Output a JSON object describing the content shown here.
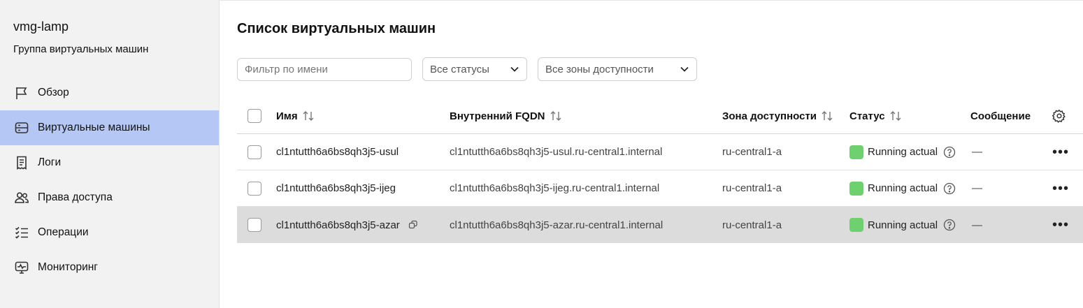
{
  "sidebar": {
    "title": "vmg-lamp",
    "subtitle": "Группа виртуальных машин",
    "items": [
      {
        "label": "Обзор",
        "icon": "flag-icon",
        "active": false
      },
      {
        "label": "Виртуальные машины",
        "icon": "server-icon",
        "active": true
      },
      {
        "label": "Логи",
        "icon": "receipt-icon",
        "active": false
      },
      {
        "label": "Права доступа",
        "icon": "users-icon",
        "active": false
      },
      {
        "label": "Операции",
        "icon": "checklist-icon",
        "active": false
      },
      {
        "label": "Мониторинг",
        "icon": "monitor-icon",
        "active": false
      }
    ]
  },
  "main": {
    "title": "Список виртуальных машин",
    "filter": {
      "placeholder": "Фильтр по имени",
      "value": ""
    },
    "status_select": "Все статусы",
    "zone_select": "Все зоны доступности"
  },
  "table": {
    "columns": {
      "name": "Имя",
      "fqdn": "Внутренний FQDN",
      "zone": "Зона доступности",
      "status": "Статус",
      "message": "Сообщение"
    },
    "rows": [
      {
        "name": "cl1ntutth6a6bs8qh3j5-usul",
        "fqdn": "cl1ntutth6a6bs8qh3j5-usul.ru-central1.internal",
        "zone": "ru-central1-a",
        "status": "Running actual",
        "message": "—"
      },
      {
        "name": "cl1ntutth6a6bs8qh3j5-ijeg",
        "fqdn": "cl1ntutth6a6bs8qh3j5-ijeg.ru-central1.internal",
        "zone": "ru-central1-a",
        "status": "Running actual",
        "message": "—"
      },
      {
        "name": "cl1ntutth6a6bs8qh3j5-azar",
        "fqdn": "cl1ntutth6a6bs8qh3j5-azar.ru-central1.internal",
        "zone": "ru-central1-a",
        "status": "Running actual",
        "message": "—"
      }
    ],
    "more_label": "•••"
  },
  "colors": {
    "sidebar_bg": "#f2f2f2",
    "active_item": "#b5c8f5",
    "status_running": "#6ed06e",
    "row_highlight": "#dcdcdc"
  }
}
